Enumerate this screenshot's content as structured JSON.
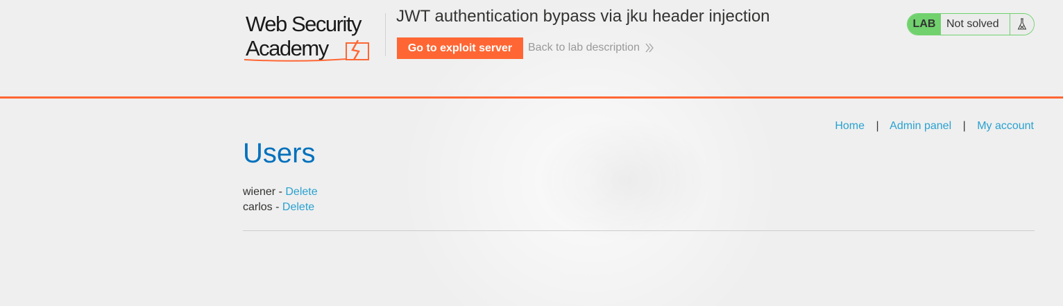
{
  "header": {
    "logo": {
      "text": "WebSecurity Academy",
      "brand_color": "#ff6633"
    },
    "lab_title": "JWT authentication bypass via jku header injection",
    "exploit_button_label": "Go to exploit server",
    "back_link_label": "Back to lab description",
    "back_link_icon": "double-chevron-right-icon",
    "status": {
      "badge": "LAB",
      "text": "Not solved",
      "icon": "flask-icon",
      "badge_color": "#70d16d"
    },
    "accent_line_color": "#ff6633"
  },
  "nav": {
    "items": [
      {
        "label": "Home"
      },
      {
        "label": "Admin panel"
      },
      {
        "label": "My account"
      }
    ],
    "separator": "|"
  },
  "main": {
    "title": "Users",
    "title_color": "#0071bc",
    "users": [
      {
        "name": "wiener",
        "separator": " - ",
        "action": "Delete"
      },
      {
        "name": "carlos",
        "separator": " - ",
        "action": "Delete"
      }
    ],
    "link_color": "#29a1d0"
  }
}
